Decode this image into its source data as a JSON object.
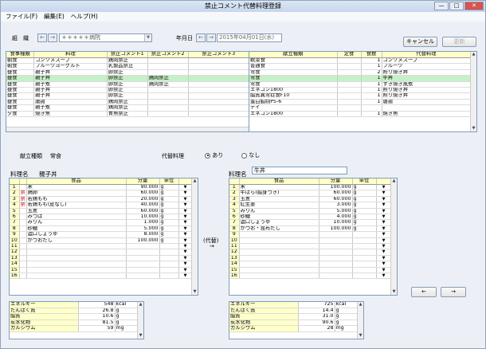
{
  "window": {
    "title": "禁止コメント代替料理登録",
    "min": "—",
    "max": "□",
    "close": "✕"
  },
  "menu": [
    "ファイル(F)",
    "編集(E)",
    "ヘルプ(H)"
  ],
  "toolbar": {
    "kumi_label": "組　織",
    "kumi_value": "＊＊＊＊＊病院",
    "date_label": "年月日",
    "date_value": "2015年04月01日(水)",
    "cancel": "キャンセル",
    "update": "更新",
    "prev": "←",
    "next": "→"
  },
  "top_grid": {
    "columns": [
      "食事種類",
      "料理",
      "禁止コメント1",
      "禁止コメント2",
      "禁止コメント3"
    ],
    "rows": [
      [
        "朝食",
        "コンソメスープ",
        "鶏肉禁止",
        "",
        ""
      ],
      [
        "朝食",
        "フルーツヨーグルト",
        "乳製品禁止",
        "",
        ""
      ],
      [
        "昼食",
        "親子丼",
        "卵禁止",
        "",
        ""
      ],
      [
        "昼食",
        "親子丼",
        "卵禁止",
        "鶏肉禁止",
        ""
      ],
      [
        "昼食",
        "親子煮",
        "卵禁止",
        "鶏肉禁止",
        ""
      ],
      [
        "昼食",
        "親子丼",
        "卵禁止",
        "",
        ""
      ],
      [
        "昼食",
        "親子丼",
        "卵禁止",
        "",
        ""
      ],
      [
        "昼食",
        "唐揚",
        "鶏肉禁止",
        "",
        ""
      ],
      [
        "昼食",
        "親子煮",
        "鶏肉禁止",
        "",
        ""
      ],
      [
        "夕食",
        "焼き魚",
        "青魚禁止",
        "",
        ""
      ]
    ],
    "highlight": 3
  },
  "right_grid": {
    "columns": [
      "献立種類",
      "定食",
      "食数",
      "代替料理"
    ],
    "rows": [
      [
        "軟菜食",
        "",
        "1",
        "コンソメスープ"
      ],
      [
        "普通食",
        "",
        "1",
        "フルーツ"
      ],
      [
        "常食",
        "",
        "2",
        "照り焼き丼"
      ],
      [
        "常食",
        "",
        "1",
        "牛丼"
      ],
      [
        "常食",
        "",
        "1",
        "すき焼き風煮"
      ],
      [
        "エネコン1800",
        "",
        "1",
        "照り焼き丼"
      ],
      [
        "脂質異常症食F10",
        "",
        "1",
        "照り焼き丼"
      ],
      [
        "蛋白脂制P5-6",
        "",
        "1",
        "唐揚"
      ],
      [
        "デイ",
        "",
        "",
        ""
      ],
      [
        "エネコン1800",
        "",
        "1",
        "焼き魚"
      ]
    ],
    "highlight": 3
  },
  "detail": {
    "kondate_label": "献立種類",
    "kondate_value": "常食",
    "daitai_label": "代替料理",
    "opt_ari": "あり",
    "opt_nashi": "なし",
    "ryouri_label": "料理名",
    "ryouri_left": "親子丼",
    "ryouri_right": "牛丼",
    "kaeru": "(代替)",
    "arrow": "→"
  },
  "food_cols": [
    "食品",
    "分量",
    "単位"
  ],
  "left_foods": [
    [
      "",
      "米",
      "90.000",
      "g"
    ],
    [
      "禁",
      "鶏卵",
      "60.000",
      "g"
    ],
    [
      "禁",
      "若鶏もも",
      "20.000",
      "g"
    ],
    [
      "禁",
      "若鶏もも(皮なし)",
      "40.000",
      "g"
    ],
    [
      "",
      "玉葱",
      "60.000",
      "g"
    ],
    [
      "",
      "みつば",
      "10.000",
      "g"
    ],
    [
      "",
      "みりん",
      "1.000",
      "g"
    ],
    [
      "",
      "砂糖",
      "5.000",
      "g"
    ],
    [
      "",
      "濃口しょうゆ",
      "8.000",
      "g"
    ],
    [
      "",
      "かつおだし",
      "100.000",
      "g"
    ],
    [
      "",
      "",
      "",
      ""
    ],
    [
      "",
      "",
      "",
      ""
    ],
    [
      "",
      "",
      "",
      ""
    ],
    [
      "",
      "",
      "",
      ""
    ],
    [
      "",
      "",
      "",
      ""
    ],
    [
      "",
      "",
      "",
      ""
    ]
  ],
  "right_foods": [
    [
      "米",
      "100.000",
      "g"
    ],
    [
      "牛ばら(脂身つき)",
      "60.000",
      "g"
    ],
    [
      "玉葱",
      "60.000",
      "g"
    ],
    [
      "紅生姜",
      "3.000",
      "g"
    ],
    [
      "みりん",
      "5.000",
      "g"
    ],
    [
      "砂糖",
      "4.000",
      "g"
    ],
    [
      "濃口しょうゆ",
      "10.000",
      "g"
    ],
    [
      "かつお・昆布だし",
      "100.000",
      "g"
    ],
    [
      "",
      "",
      ""
    ],
    [
      "",
      "",
      ""
    ],
    [
      "",
      "",
      ""
    ],
    [
      "",
      "",
      ""
    ],
    [
      "",
      "",
      ""
    ],
    [
      "",
      "",
      ""
    ],
    [
      "",
      "",
      ""
    ],
    [
      "",
      "",
      ""
    ]
  ],
  "left_nutr": [
    [
      "エネルギー",
      "548",
      "kcal"
    ],
    [
      "たんぱく質",
      "26.8",
      "g"
    ],
    [
      "脂質",
      "10.6",
      "g"
    ],
    [
      "炭水化物",
      "81.5",
      "g"
    ],
    [
      "カルシウム",
      "59",
      "mg"
    ]
  ],
  "right_nutr": [
    [
      "エネルギー",
      "725",
      "kcal"
    ],
    [
      "たんぱく質",
      "14.4",
      "g"
    ],
    [
      "脂質",
      "31.0",
      "g"
    ],
    [
      "炭水化物",
      "90.6",
      "g"
    ],
    [
      "カルシウム",
      "28",
      "mg"
    ]
  ]
}
